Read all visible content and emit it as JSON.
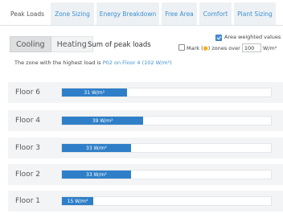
{
  "tabs": [
    {
      "label": "Peak Loads",
      "active": true
    },
    {
      "label": "Zone Sizing",
      "active": false
    },
    {
      "label": "Energy Breakdown",
      "active": false
    },
    {
      "label": "Free Area",
      "active": false
    },
    {
      "label": "Comfort",
      "active": false
    },
    {
      "label": "Plant Sizing",
      "active": false
    }
  ],
  "toolbar": {
    "cooling_label": "Cooling",
    "heating_label": "Heating",
    "selected_mode": "Cooling",
    "sum_label": "Sum of peak loads",
    "area_weighted_label": "Area weighted values",
    "area_weighted_checked": true,
    "mark_prefix": "Mark (",
    "mark_icon": "sun-icon",
    "mark_suffix": ") zones over",
    "mark_checked": false,
    "mark_value": "100",
    "mark_unit": "W/m²"
  },
  "info": {
    "prefix": "The zone with the highest load is ",
    "link": "P02 on Floor 4 (102 W/m²)"
  },
  "colors": {
    "accent": "#3d8fd1",
    "bar": "#2f7fc8",
    "row_bg": "#f3f4f5"
  },
  "floors": [
    {
      "label": "Floor 6",
      "value_text": "31 W/m²",
      "fraction": 0.31
    },
    {
      "label": "Floor 4",
      "value_text": "39 W/m²",
      "fraction": 0.39
    },
    {
      "label": "Floor 3",
      "value_text": "33 W/m²",
      "fraction": 0.33
    },
    {
      "label": "Floor 2",
      "value_text": "33 W/m²",
      "fraction": 0.33
    },
    {
      "label": "Floor 1",
      "value_text": "15 W/m²",
      "fraction": 0.15
    }
  ]
}
